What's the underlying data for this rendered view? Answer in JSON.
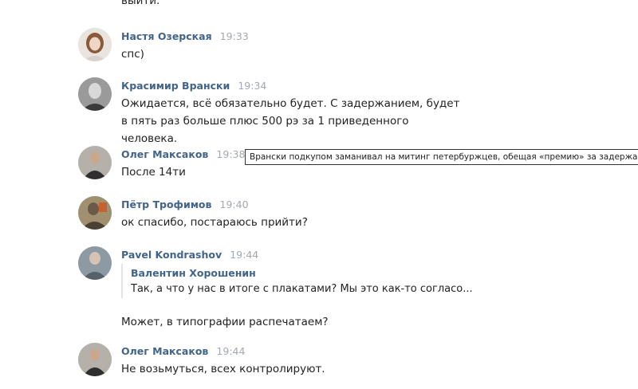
{
  "top_fragment": "выйти.",
  "messages": [
    {
      "author": "Настя Озерская",
      "time": "19:33",
      "text": "спс)",
      "avatar_icon": "user-avatar-woman"
    },
    {
      "author": "Красимир Врански",
      "time": "19:34",
      "text": "Ожидается, всё обязательно будет. С задержанием, будет в пять раз больше плюс 500 рэ за 1 приведенного человека.",
      "avatar_icon": "user-avatar-man"
    },
    {
      "author": "Олег Максаков",
      "time": "19:38",
      "text": "После 14ти",
      "avatar_icon": "user-avatar-man"
    },
    {
      "author": "Пётр Трофимов",
      "time": "19:40",
      "text": "ок спасибо, постараюсь прийти?",
      "avatar_icon": "user-avatar-man"
    },
    {
      "author": "Pavel Kondrashov",
      "time": "19:44",
      "quote_author": "Валентин Хорошенин",
      "quote_text": "Так, а что у нас в итоге с плакатами? Мы это как-то согласо...",
      "text": "Может, в типографии распечатаем?",
      "avatar_icon": "user-avatar-man"
    },
    {
      "author": "Олег Максаков",
      "time": "19:44",
      "text": "Не возьмуться, всех контролируют.",
      "avatar_icon": "user-avatar-man"
    }
  ],
  "caption": "Врански подкупом заманивал на митинг петербуржцев, обещая «премию» за задержание",
  "colors": {
    "author": "#42648b",
    "time": "#a3a9b1",
    "text": "#222222",
    "quote_border": "#dfe4ea"
  }
}
